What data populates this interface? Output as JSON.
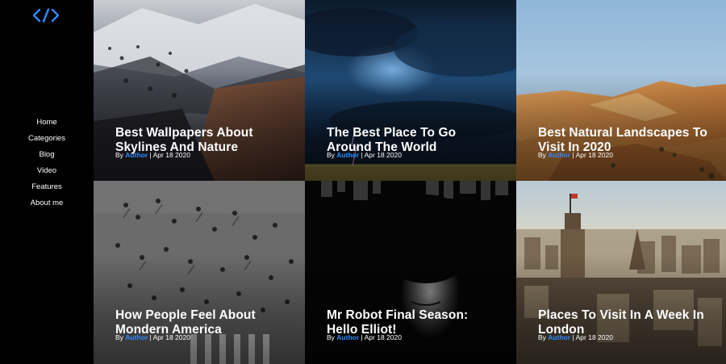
{
  "logo": {
    "icon": "code-brackets-icon",
    "color": "#2d8cff"
  },
  "nav": {
    "items": [
      {
        "label": "Home"
      },
      {
        "label": "Categories"
      },
      {
        "label": "Blog"
      },
      {
        "label": "Video"
      },
      {
        "label": "Features"
      },
      {
        "label": "About me"
      }
    ]
  },
  "posts": [
    {
      "title": "Best Wallpapers About Skylines And Nature",
      "by": "By",
      "author": "Author",
      "date": "| Apr 18 2020",
      "image": "snowy-mountain"
    },
    {
      "title": "The Best Place To Go Around The World",
      "by": "By",
      "author": "Author",
      "date": "| Apr 18 2020",
      "image": "storm-clouds"
    },
    {
      "title": "Best Natural Landscapes To Visit In 2020",
      "by": "By",
      "author": "Author",
      "date": "| Apr 18 2020",
      "image": "desert-dunes"
    },
    {
      "title": "How People Feel About Mondern America",
      "by": "By",
      "author": "Author",
      "date": "| Apr 18 2020",
      "image": "crowd-crosswalk"
    },
    {
      "title": "Mr Robot Final Season: Hello Elliot!",
      "by": "By",
      "author": "Author",
      "date": "| Apr 18 2020",
      "image": "hooded-face"
    },
    {
      "title": "Places To Visit In A Week In London",
      "by": "By",
      "author": "Author",
      "date": "| Apr 18 2020",
      "image": "london-skyline"
    }
  ],
  "colors": {
    "accent": "#2d8cff",
    "background": "#000000",
    "text": "#ffffff"
  }
}
